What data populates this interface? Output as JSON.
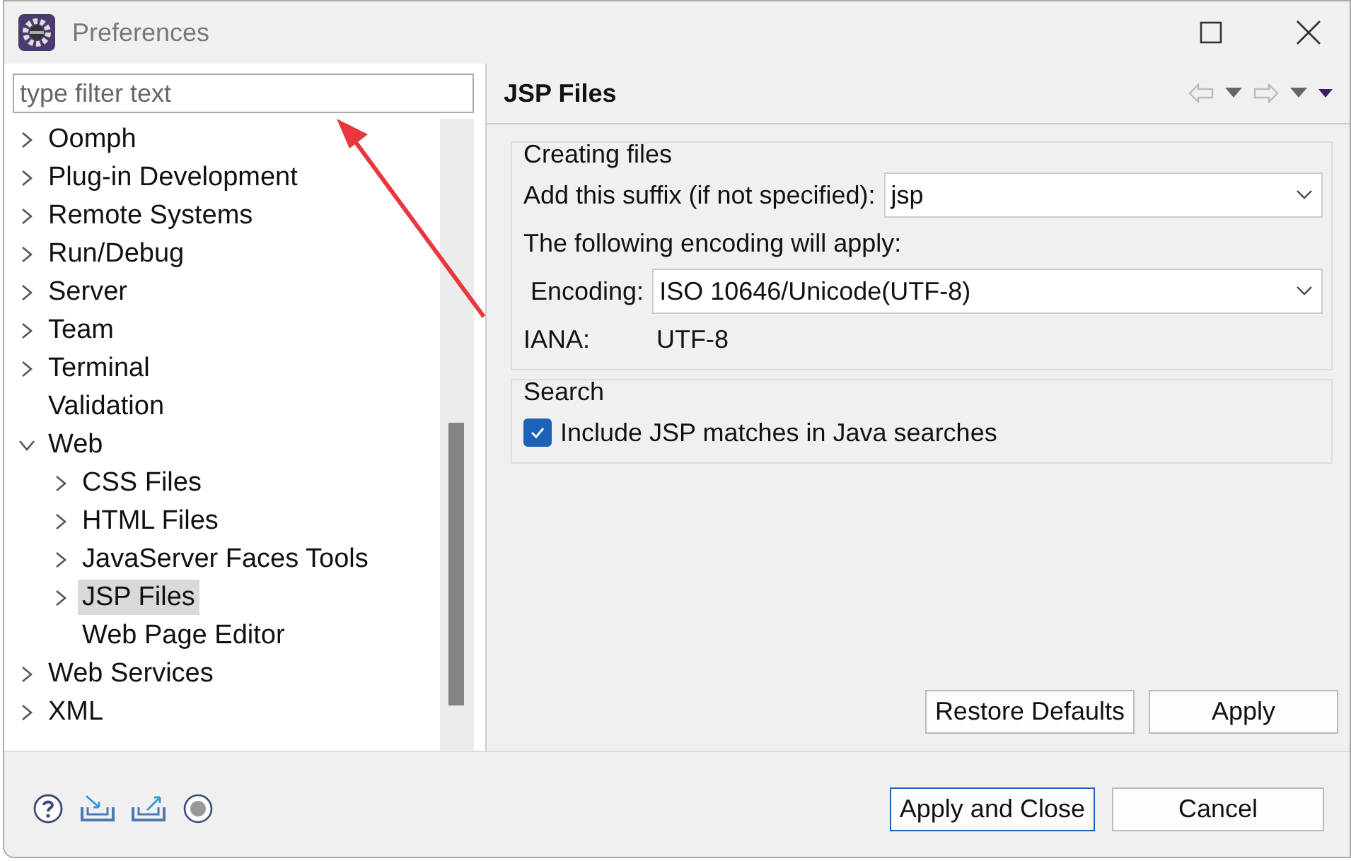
{
  "window": {
    "title": "Preferences"
  },
  "filter": {
    "placeholder": "type filter text"
  },
  "tree": [
    {
      "label": "Oomph",
      "expanded": false,
      "selected": false
    },
    {
      "label": "Plug-in Development",
      "expanded": false,
      "selected": false
    },
    {
      "label": "Remote Systems",
      "expanded": false,
      "selected": false
    },
    {
      "label": "Run/Debug",
      "expanded": false,
      "selected": false
    },
    {
      "label": "Server",
      "expanded": false,
      "selected": false
    },
    {
      "label": "Team",
      "expanded": false,
      "selected": false
    },
    {
      "label": "Terminal",
      "expanded": false,
      "selected": false
    },
    {
      "label": "Validation",
      "selected": false
    },
    {
      "label": "Web",
      "expanded": true,
      "selected": false,
      "children": [
        {
          "label": "CSS Files",
          "expanded": false,
          "selected": false
        },
        {
          "label": "HTML Files",
          "expanded": false,
          "selected": false
        },
        {
          "label": "JavaServer Faces Tools",
          "expanded": false,
          "selected": false
        },
        {
          "label": "JSP Files",
          "expanded": false,
          "selected": true
        },
        {
          "label": "Web Page Editor",
          "selected": false
        }
      ]
    },
    {
      "label": "Web Services",
      "expanded": false,
      "selected": false
    },
    {
      "label": "XML",
      "expanded": false,
      "selected": false
    }
  ],
  "page": {
    "title": "JSP Files",
    "groups": [
      {
        "title": "Creating files",
        "rows": [
          {
            "kind": "combo",
            "label": "Add this suffix (if not specified):",
            "value": "jsp"
          },
          {
            "kind": "text",
            "label": "The following encoding will apply:"
          },
          {
            "kind": "combo",
            "label": "Encoding:",
            "value": "ISO 10646/Unicode(UTF-8)",
            "indent": true
          },
          {
            "kind": "pair",
            "label": "IANA:",
            "value": "UTF-8"
          }
        ]
      },
      {
        "title": "Search",
        "rows": [
          {
            "kind": "check",
            "label": "Include JSP matches in Java searches",
            "checked": true
          }
        ]
      }
    ],
    "buttons": [
      "Restore Defaults",
      "Apply"
    ]
  },
  "footer_buttons": [
    {
      "label": "Apply and Close",
      "default": true
    },
    {
      "label": "Cancel",
      "default": false
    }
  ],
  "annotations": [
    {
      "kind": "arrow"
    }
  ]
}
